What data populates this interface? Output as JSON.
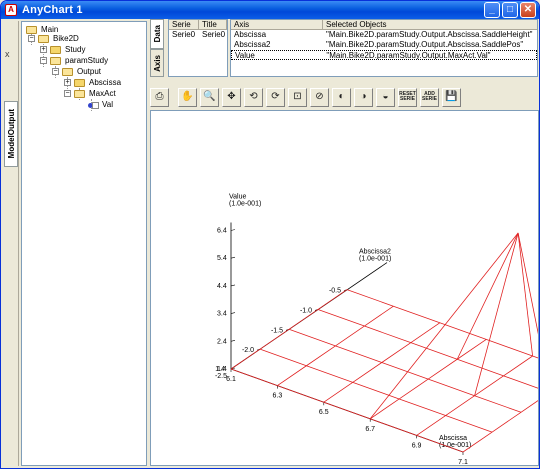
{
  "window": {
    "title": "AnyChart 1",
    "app_icon_letter": "A",
    "minimize_glyph": "_",
    "maximize_glyph": "□",
    "close_glyph": "✕"
  },
  "side_panel": {
    "close_glyph": "x",
    "tab_label": "ModelOutput"
  },
  "tree": {
    "items": [
      {
        "label": "Main",
        "expander": ""
      },
      {
        "label": "Bike2D",
        "expander": "−"
      },
      {
        "label": "Study",
        "expander": "+"
      },
      {
        "label": "paramStudy",
        "expander": "−"
      },
      {
        "label": "Output",
        "expander": "−"
      },
      {
        "label": "Abscissa",
        "expander": "+"
      },
      {
        "label": "MaxAct",
        "expander": "−"
      },
      {
        "label": "Val",
        "expander": ""
      }
    ]
  },
  "tabs": {
    "data": "Data",
    "axis": "Axis"
  },
  "serie_table": {
    "headers": [
      "Serie",
      "Title"
    ],
    "rows": [
      [
        "Serie0",
        "Serie0"
      ]
    ]
  },
  "axis_table": {
    "headers": [
      "Axis",
      "Selected Objects"
    ],
    "rows": [
      [
        "Abscissa",
        "\"Main.Bike2D.paramStudy.Output.Abscissa.SaddleHeight\""
      ],
      [
        "Abscissa2",
        "\"Main.Bike2D.paramStudy.Output.Abscissa.SaddlePos\""
      ],
      [
        "Value",
        "\"Main.Bike2D.paramStudy.Output.MaxAct.Val\""
      ]
    ]
  },
  "toolbar": {
    "buttons": [
      {
        "icon": "print-icon",
        "glyph": "⎙"
      },
      {
        "icon": "pan-hand-icon",
        "glyph": "✋"
      },
      {
        "icon": "zoom-icon",
        "glyph": "🔍"
      },
      {
        "icon": "move-icon",
        "glyph": "✥"
      },
      {
        "icon": "rotate-icon",
        "glyph": "⟲"
      },
      {
        "icon": "rotate-axis-icon",
        "glyph": "⟳"
      },
      {
        "icon": "zoom-box-icon",
        "glyph": "⊡"
      },
      {
        "icon": "zoom-axis-icon",
        "glyph": "⊘"
      },
      {
        "icon": "view-front-icon",
        "glyph": "◐"
      },
      {
        "icon": "view-side-icon",
        "glyph": "◑"
      },
      {
        "icon": "view-top-icon",
        "glyph": "◒"
      },
      {
        "icon": "reset-serie-icon",
        "label": "RESET SERIE"
      },
      {
        "icon": "add-serie-icon",
        "label": "ADD SERIE"
      },
      {
        "icon": "save-icon",
        "glyph": "💾"
      }
    ]
  },
  "chart_data": {
    "type": "surface-3d",
    "line_color": "#e02020",
    "axes": {
      "value": {
        "label": "Value",
        "unit": "(1.0e-001)",
        "ticks": [
          "1.4",
          "2.4",
          "3.4",
          "4.4",
          "5.4",
          "6.4"
        ],
        "range": [
          1.4,
          6.4
        ]
      },
      "abscissa2": {
        "label": "Abscissa2",
        "unit": "(1.0e-001)",
        "ticks": [
          "-2.0",
          "-1.5",
          "-1.0",
          "-0.5"
        ],
        "range": [
          -2.0,
          -0.5
        ]
      },
      "abscissa": {
        "label": "Abscissa",
        "unit": "(1.0e-001)",
        "ticks": [
          "6.1",
          "6.3",
          "6.5",
          "6.7",
          "6.9",
          "7.1"
        ],
        "range": [
          6.1,
          7.1
        ]
      }
    },
    "origin_labels": [
      "1.4",
      "-2.5"
    ],
    "grid": {
      "abscissa": [
        6.1,
        6.3,
        6.5,
        6.7,
        6.9,
        7.1
      ],
      "abscissa2": [
        -2.5,
        -2.0,
        -1.5,
        -1.0,
        -0.5
      ],
      "values": [
        [
          1.4,
          1.4,
          1.4,
          1.4,
          1.4
        ],
        [
          1.4,
          1.4,
          1.4,
          1.4,
          1.4
        ],
        [
          1.4,
          1.4,
          1.4,
          1.4,
          1.4
        ],
        [
          1.4,
          1.4,
          1.4,
          1.4,
          1.4
        ],
        [
          1.4,
          1.4,
          1.4,
          1.4,
          1.4
        ],
        [
          1.4,
          1.4,
          1.4,
          1.4,
          1.4
        ]
      ]
    },
    "peak": {
      "abscissa": 6.9,
      "abscissa2": -0.75,
      "value": 6.2
    }
  }
}
